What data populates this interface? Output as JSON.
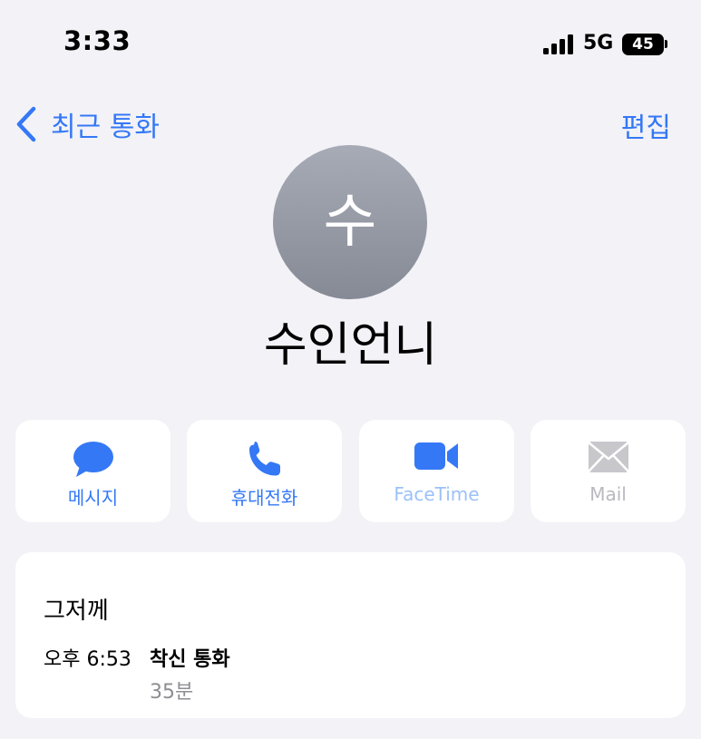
{
  "status_bar": {
    "time": "3:33",
    "network": "5G",
    "battery": "45",
    "icons": [
      "signal-icon",
      "battery-icon"
    ]
  },
  "nav": {
    "back_label": "최근 통화",
    "edit_label": "편집",
    "icons": [
      "chevron-left-icon"
    ]
  },
  "contact": {
    "avatar_initial": "수",
    "name": "수인언니"
  },
  "actions": [
    {
      "label": "메시지",
      "icon": "message-icon",
      "enabled": true
    },
    {
      "label": "휴대전화",
      "icon": "phone-icon",
      "enabled": true
    },
    {
      "label": "FaceTime",
      "icon": "video-icon",
      "enabled": true
    },
    {
      "label": "Mail",
      "icon": "mail-icon",
      "enabled": false
    }
  ],
  "history": {
    "date": "그저께",
    "time": "오후 6:53",
    "type": "착신 통화",
    "duration": "35분"
  },
  "colors": {
    "accent": "#3478f6",
    "background": "#f2f2f7",
    "card": "#ffffff",
    "disabled": "#b9b9bf",
    "secondary_text": "#8e8e93"
  }
}
